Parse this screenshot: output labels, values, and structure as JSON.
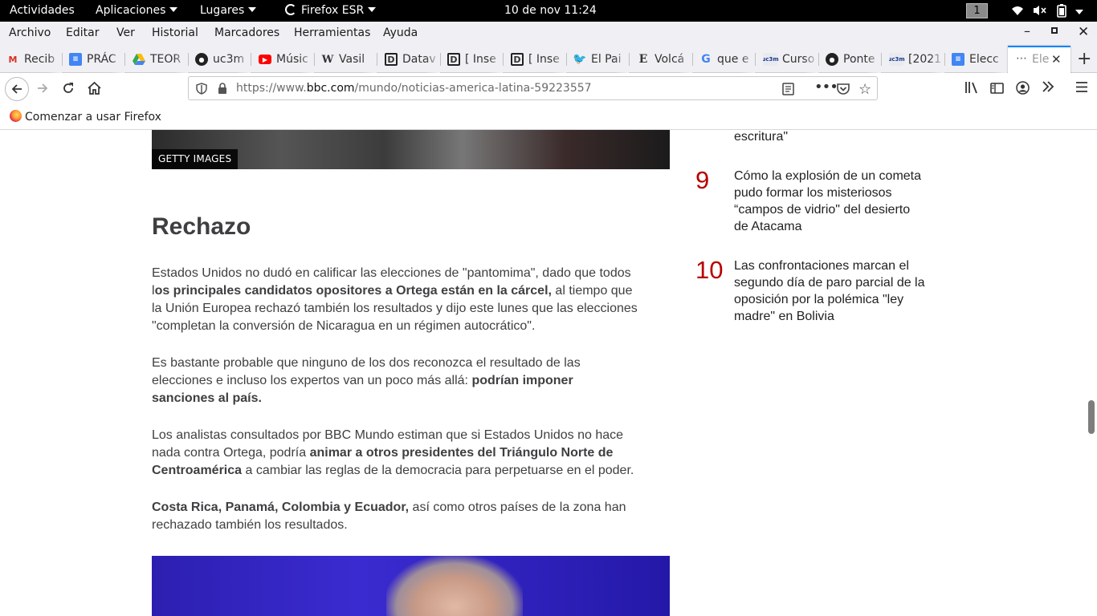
{
  "gnome": {
    "activities": "Actividades",
    "applications": "Aplicaciones",
    "places": "Lugares",
    "app": "Firefox ESR",
    "clock": "10 de nov  11:24",
    "workspace": "1"
  },
  "menu": [
    "Archivo",
    "Editar",
    "Ver",
    "Historial",
    "Marcadores",
    "Herramientas",
    "Ayuda"
  ],
  "tabs": [
    {
      "label": "Recib",
      "icon": "gmail-icon",
      "color": "#d93025"
    },
    {
      "label": "PRÁC",
      "icon": "google-docs-icon",
      "color": "#4285f4"
    },
    {
      "label": "TEOR",
      "icon": "google-drive-icon",
      "color": "#fbbc04"
    },
    {
      "label": "uc3m",
      "icon": "github-icon",
      "color": "#222222"
    },
    {
      "label": "Músic",
      "icon": "youtube-icon",
      "color": "#ff0000"
    },
    {
      "label": "Vasil",
      "icon": "wikipedia-icon",
      "color": "#222222"
    },
    {
      "label": "Datav",
      "icon": "d-site-icon",
      "color": "#222222"
    },
    {
      "label": "[ Inse",
      "icon": "d-site-icon",
      "color": "#222222"
    },
    {
      "label": "[ Inse",
      "icon": "d-site-icon",
      "color": "#222222"
    },
    {
      "label": "El Pai",
      "icon": "twitter-icon",
      "color": "#1da1f2"
    },
    {
      "label": "Volcá",
      "icon": "e-site-icon",
      "color": "#222222"
    },
    {
      "label": "que e",
      "icon": "google-icon",
      "color": "#4285f4"
    },
    {
      "label": "Curso",
      "icon": "uc3m-icon",
      "color": "#1a3a8a"
    },
    {
      "label": "Ponte",
      "icon": "github-icon",
      "color": "#222222"
    },
    {
      "label": "[2021",
      "icon": "uc3m-icon",
      "color": "#1a3a8a"
    },
    {
      "label": "Elecc",
      "icon": "google-docs-icon",
      "color": "#4285f4"
    }
  ],
  "active_tab": {
    "label": "Ele"
  },
  "url": {
    "prefix": "https://www.",
    "domain": "bbc.com",
    "path": "/mundo/noticias-america-latina-59223557"
  },
  "bookmark": "Comenzar a usar Firefox",
  "article": {
    "credit": "GETTY IMAGES",
    "heading": "Rechazo",
    "p1a": "Estados Unidos no dudó en calificar las elecciones de \"pantomima\", dado que todos l",
    "p1b": "os principales candidatos opositores a Ortega están en la cárcel,",
    "p1c": " al tiempo que la Unión Europea rechazó también los resultados y dijo este lunes que las elecciones \"completan la conversión de Nicaragua en un régimen autocrático\".",
    "p2a": "Es bastante probable que ninguno de los dos reconozca el resultado de las elecciones e incluso los expertos van un poco más allá: ",
    "p2b": "podrían imponer sanciones al país.",
    "p3a": "Los analistas consultados por BBC Mundo estiman que si Estados Unidos no hace nada contra Ortega, podría ",
    "p3b": "animar a otros presidentes del Triángulo Norte de Centroamérica",
    "p3c": " a cambiar las reglas de la democracia para perpetuarse en el poder.",
    "p4a": "Costa Rica, Panamá, Colombia y Ecuador,",
    "p4b": " así como otros países de la zona han rechazado también los resultados."
  },
  "most_popular": {
    "prev_tail": "escritura\"",
    "items": [
      {
        "rank": "9",
        "text": "Cómo la explosión de un cometa pudo formar los misteriosos “campos de vidrio\" del desierto de Atacama"
      },
      {
        "rank": "10",
        "text": "Las confrontaciones marcan el segundo día de paro parcial de la oposición por la polémica \"ley madre\" en Bolivia"
      }
    ]
  }
}
